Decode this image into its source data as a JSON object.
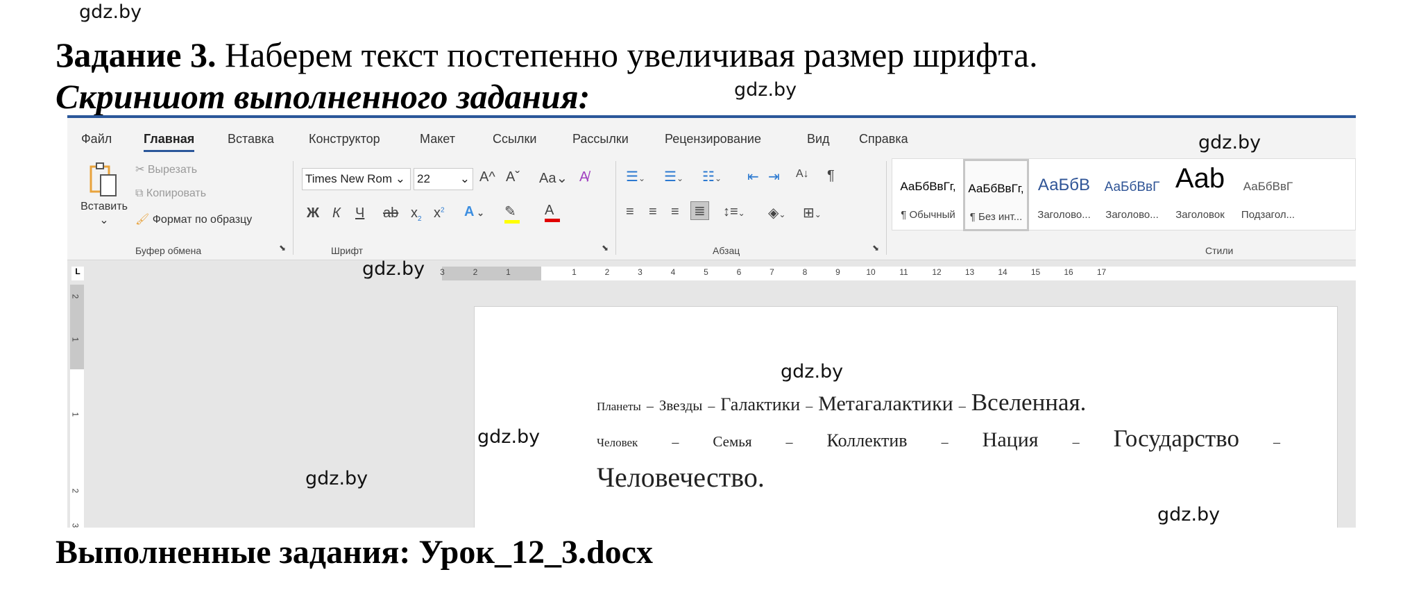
{
  "watermark": "gdz.by",
  "heading": {
    "label": "Задание 3.",
    "text": "Наберем текст постепенно увеличивая размер шрифта."
  },
  "subheading": "Скриншот выполненного задания:",
  "footer": "Выполненные задания: Урок_12_3.docx",
  "ribbon": {
    "accent": "#2b579a",
    "tabs": [
      "Файл",
      "Главная",
      "Вставка",
      "Конструктор",
      "Макет",
      "Ссылки",
      "Рассылки",
      "Рецензирование",
      "Вид",
      "Справка"
    ],
    "active_tab": "Главная",
    "clipboard": {
      "paste": "Вставить",
      "cut": "Вырезать",
      "copy": "Копировать",
      "format_painter": "Формат по образцу",
      "group": "Буфер обмена"
    },
    "font": {
      "name": "Times New Rom",
      "size": "22",
      "grow": "A",
      "shrink": "A",
      "case": "Aa",
      "bold": "Ж",
      "italic": "К",
      "underline": "Ч",
      "strike": "ab",
      "sub": "x",
      "sup": "x",
      "effects": "A",
      "highlight": "#ffff00",
      "color": "#e00000",
      "color_glyph": "A",
      "group": "Шрифт"
    },
    "paragraph": {
      "group": "Абзац",
      "pilcrow": "¶",
      "sort": "А↓"
    },
    "styles": {
      "group": "Стили",
      "items": [
        {
          "preview": "АаБбВвГг,",
          "name": "¶ Обычный"
        },
        {
          "preview": "АаБбВвГг,",
          "name": "¶ Без инт..."
        },
        {
          "preview": "АаБбВ",
          "name": "Заголово..."
        },
        {
          "preview": "АаБбВвГ",
          "name": "Заголово..."
        },
        {
          "preview": "Aab",
          "name": "Заголовок"
        },
        {
          "preview": "АаБбВвГ",
          "name": "Подзагол..."
        }
      ],
      "selected_index": 1
    }
  },
  "ruler": {
    "negative": [
      "3",
      "2",
      "1"
    ],
    "positive": [
      "1",
      "2",
      "3",
      "4",
      "5",
      "6",
      "7",
      "8",
      "9",
      "10",
      "11",
      "12",
      "13",
      "14",
      "15",
      "16",
      "17"
    ],
    "vertical": [
      "2",
      "1",
      "1",
      "2",
      "3"
    ]
  },
  "document": {
    "line1": [
      "Планеты",
      "Звезды",
      "Галактики",
      "Метагалактики",
      "Вселенная."
    ],
    "line2": [
      "Человек",
      "Семья",
      "Коллектив",
      "Нация",
      "Государство"
    ],
    "line3": "Человечество.",
    "dash": "–"
  }
}
